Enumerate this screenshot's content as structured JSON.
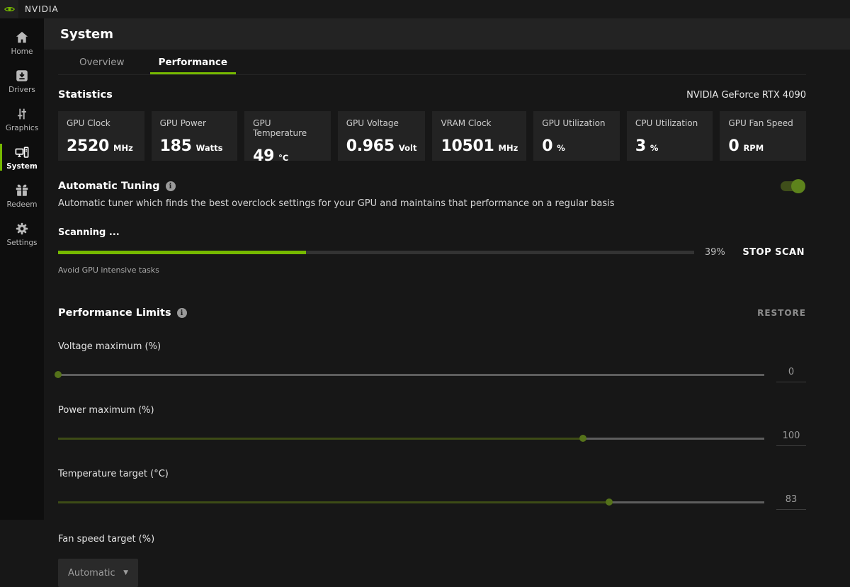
{
  "topbar": {
    "brand": "NVIDIA"
  },
  "sidebar": {
    "items": [
      {
        "label": "Home"
      },
      {
        "label": "Drivers"
      },
      {
        "label": "Graphics"
      },
      {
        "label": "System"
      },
      {
        "label": "Redeem"
      },
      {
        "label": "Settings"
      }
    ]
  },
  "header": {
    "title": "System"
  },
  "tabs": {
    "overview": "Overview",
    "performance": "Performance"
  },
  "statistics": {
    "title": "Statistics",
    "gpu_name": "NVIDIA GeForce RTX 4090",
    "cards": [
      {
        "label": "GPU Clock",
        "value": "2520",
        "unit": "MHz"
      },
      {
        "label": "GPU Power",
        "value": "185",
        "unit": "Watts"
      },
      {
        "label": "GPU Temperature",
        "value": "49",
        "unit": "°C"
      },
      {
        "label": "GPU Voltage",
        "value": "0.965",
        "unit": "Volt"
      },
      {
        "label": "VRAM Clock",
        "value": "10501",
        "unit": "MHz"
      },
      {
        "label": "GPU Utilization",
        "value": "0",
        "unit": "%"
      },
      {
        "label": "CPU Utilization",
        "value": "3",
        "unit": "%"
      },
      {
        "label": "GPU Fan Speed",
        "value": "0",
        "unit": "RPM"
      }
    ]
  },
  "automatic_tuning": {
    "title": "Automatic Tuning",
    "info_icon": "i",
    "toggle_on": true,
    "description": "Automatic tuner which finds the best overclock settings for your GPU and maintains that performance on a regular basis",
    "scan": {
      "status": "Scanning ...",
      "progress_value": 39,
      "progress_label": "39%",
      "stop_button": "STOP SCAN",
      "hint": "Avoid GPU intensive tasks"
    }
  },
  "performance_limits": {
    "title": "Performance Limits",
    "info_icon": "i",
    "restore_button": "RESTORE",
    "sliders": [
      {
        "label": "Voltage maximum (%)",
        "value": "0",
        "percent": 0
      },
      {
        "label": "Power maximum (%)",
        "value": "100",
        "percent": 74.3
      },
      {
        "label": "Temperature target (°C)",
        "value": "83",
        "percent": 78
      }
    ],
    "fan": {
      "label": "Fan speed target (%)",
      "selected": "Automatic"
    }
  },
  "colors": {
    "accent": "#76b900"
  }
}
